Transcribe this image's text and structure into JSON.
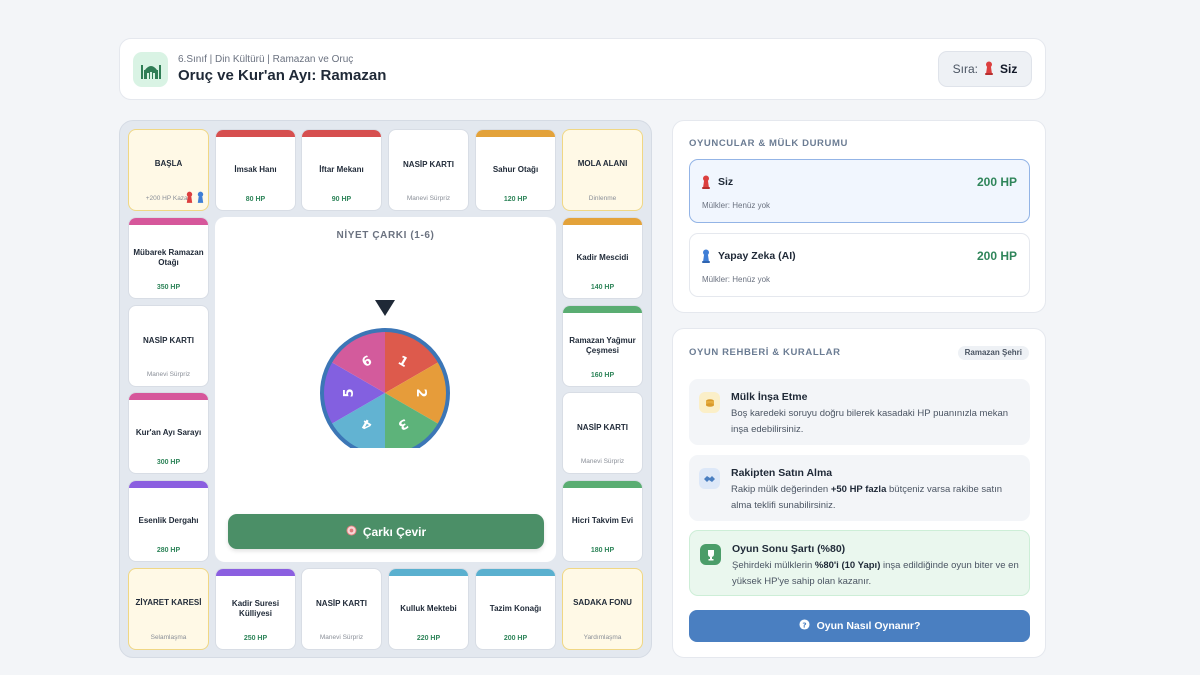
{
  "header": {
    "breadcrumb": "6.Sınıf | Din Kültürü | Ramazan ve Oruç",
    "title": "Oruç ve Kur'an Ayı: Ramazan",
    "turn_label": "Sıra:",
    "turn_value": "Siz"
  },
  "board": {
    "corners": {
      "start": {
        "name": "BAŞLA",
        "sub": "+200 HP Kazan"
      },
      "rest": {
        "name": "MOLA ALANI",
        "sub": "Dinlenme"
      },
      "visit": {
        "name": "ZİYARET KARESİ",
        "sub": "Selamlaşma"
      },
      "charity": {
        "name": "SADAKA FONU",
        "sub": "Yardımlaşma"
      }
    },
    "top": [
      {
        "name": "İmsak Hanı",
        "price": "80 HP",
        "color": "#d64f4f"
      },
      {
        "name": "İftar Mekanı",
        "price": "90 HP",
        "color": "#d64f4f"
      },
      {
        "name": "NASİP KARTI",
        "sub": "Manevi Sürpriz"
      },
      {
        "name": "Sahur Otağı",
        "price": "120 HP",
        "color": "#e3a23a"
      }
    ],
    "left": [
      {
        "name": "Mübarek Ramazan Otağı",
        "price": "350 HP",
        "color": "#d6579b"
      },
      {
        "name": "NASİP KARTI",
        "sub": "Manevi Sürpriz"
      },
      {
        "name": "Kur'an Ayı Sarayı",
        "price": "300 HP",
        "color": "#d6579b"
      },
      {
        "name": "Esenlik Dergahı",
        "price": "280 HP",
        "color": "#8b5fe0"
      }
    ],
    "right": [
      {
        "name": "Kadir Mescidi",
        "price": "140 HP",
        "color": "#e3a23a"
      },
      {
        "name": "Ramazan Yağmur Çeşmesi",
        "price": "160 HP",
        "color": "#5aad72"
      },
      {
        "name": "NASİP KARTI",
        "sub": "Manevi Sürpriz"
      },
      {
        "name": "Hicri Takvim Evi",
        "price": "180 HP",
        "color": "#5aad72"
      }
    ],
    "bottom": [
      {
        "name": "Kadir Suresi Külliyesi",
        "price": "250 HP",
        "color": "#8b5fe0"
      },
      {
        "name": "NASİP KARTI",
        "sub": "Manevi Sürpriz"
      },
      {
        "name": "Kulluk Mektebi",
        "price": "220 HP",
        "color": "#5ab0cf"
      },
      {
        "name": "Tazim Konağı",
        "price": "200 HP",
        "color": "#5ab0cf"
      }
    ],
    "wheel_title": "NİYET ÇARKI (1-6)",
    "wheel_numbers": [
      "1",
      "2",
      "3",
      "4",
      "5",
      "6"
    ],
    "wheel_colors": [
      "#dd5a4c",
      "#e69c3a",
      "#5db37a",
      "#62b3d2",
      "#8360e0",
      "#d35b9c"
    ],
    "spin_button": "Çarkı Çevir"
  },
  "players": {
    "title": "OYUNCULAR & MÜLK DURUMU",
    "list": [
      {
        "name": "Siz",
        "hp": "200 HP",
        "props": "Mülkler: Henüz yok",
        "color": "#dc3f3f"
      },
      {
        "name": "Yapay Zeka (AI)",
        "hp": "200 HP",
        "props": "Mülkler: Henüz yok",
        "color": "#3f7ed6"
      }
    ]
  },
  "guide": {
    "title": "OYUN REHBERİ & KURALLAR",
    "tag": "Ramazan Şehri",
    "rules": [
      {
        "title": "Mülk İnşa Etme",
        "text": "Boş karedeki soruyu doğru bilerek kasadaki HP puanınızla mekan inşa edebilirsiniz."
      },
      {
        "title": "Rakipten Satın Alma",
        "text_a": "Rakip mülk değerinden ",
        "text_b": "+50 HP fazla",
        "text_c": " bütçeniz varsa rakibe satın alma teklifi sunabilirsiniz."
      },
      {
        "title": "Oyun Sonu Şartı (%80)",
        "text_a": "Şehirdeki mülklerin ",
        "text_b": "%80'i (10 Yapı)",
        "text_c": " inşa edildiğinde oyun biter ve en yüksek HP'ye sahip olan kazanır."
      }
    ],
    "how_button": "Oyun Nasıl Oynanır?"
  }
}
